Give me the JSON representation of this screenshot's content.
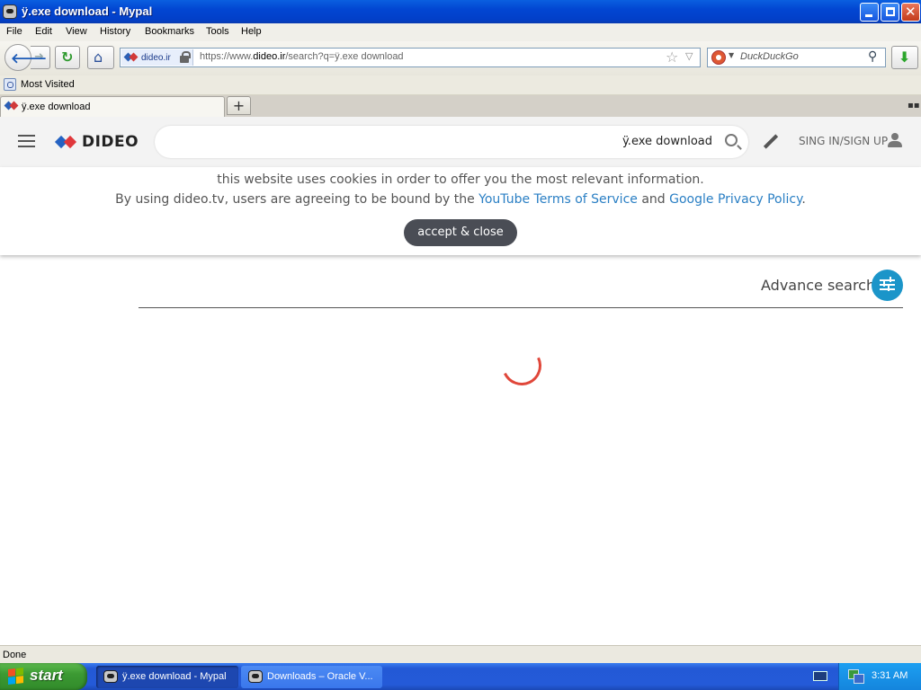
{
  "window": {
    "title": "ÿ.exe download - Mypal"
  },
  "menubar": {
    "items": [
      "File",
      "Edit",
      "View",
      "History",
      "Bookmarks",
      "Tools",
      "Help"
    ]
  },
  "navbar": {
    "site_identity": "dideo.ir",
    "url_prefix": "https://www.",
    "url_domain": "dideo.ir",
    "url_path": "/search?q=ÿ.exe download",
    "search_engine_placeholder": "DuckDuckGo"
  },
  "bookmarks_bar": {
    "items": [
      "Most Visited"
    ]
  },
  "tabs": [
    {
      "label": "ÿ.exe download",
      "active": true
    }
  ],
  "page": {
    "logo_text": "DIDEO",
    "search_value": "ÿ.exe download",
    "signin_label": "SING IN/SIGN UP",
    "cookie": {
      "line1": "this website uses cookies in order to offer you the most relevant information.",
      "line2_prefix": "By using dideo.tv, users are agreeing to be bound by the",
      "link1": "YouTube Terms of Service",
      "conjunction": "and",
      "link2": "Google Privacy Policy",
      "line2_suffix": ".",
      "accept_label": "accept & close"
    },
    "advance_search_label": "Advance search",
    "accent_colors": {
      "link": "#2a7fc4",
      "advance": "#1b95c9",
      "spinner": "#e0473a",
      "accept_button": "#4a4d55"
    }
  },
  "statusbar": {
    "text": "Done"
  },
  "taskbar": {
    "start_label": "start",
    "tasks": [
      {
        "label": "ÿ.exe download - Mypal",
        "active": true
      },
      {
        "label": "Downloads – Oracle V...",
        "active": false
      }
    ],
    "clock": "3:31 AM"
  }
}
